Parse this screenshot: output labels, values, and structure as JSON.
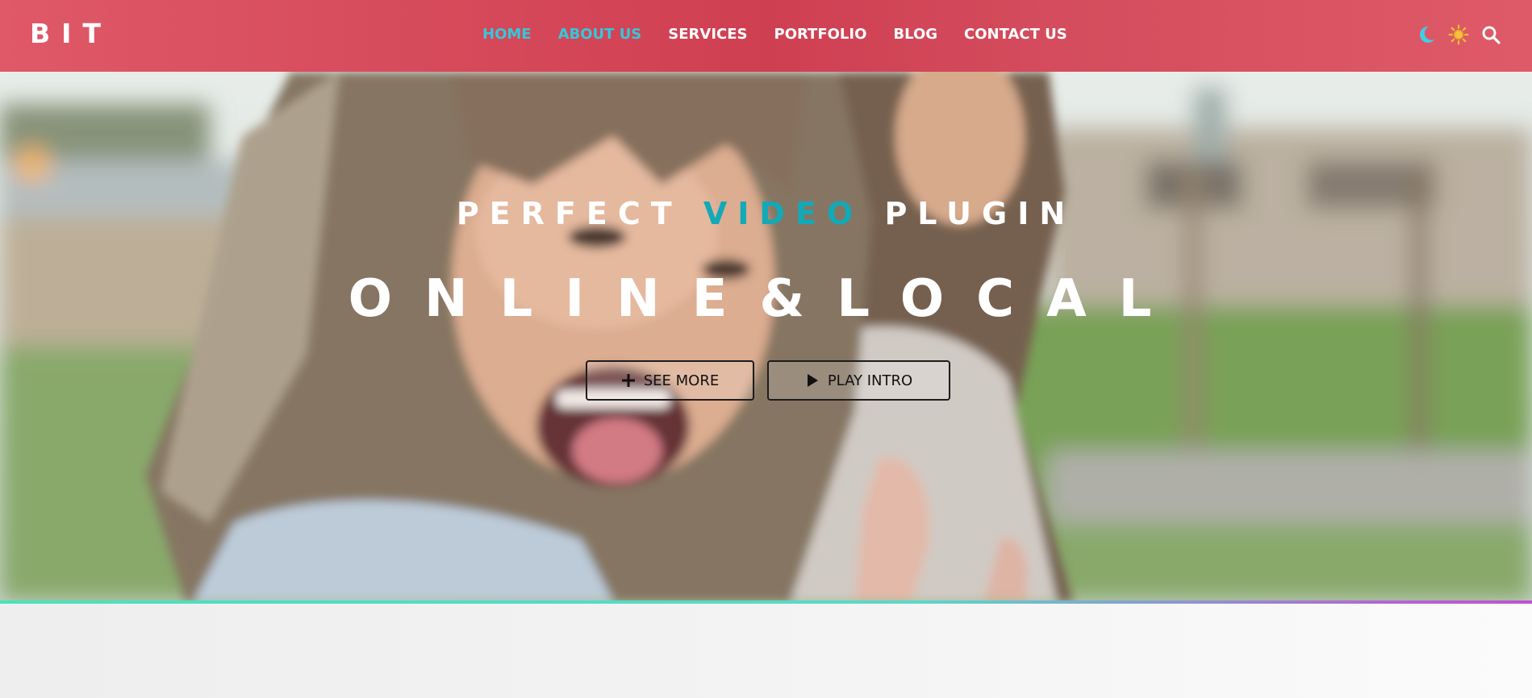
{
  "brand": {
    "logo_text": "BIT"
  },
  "nav": {
    "items": [
      {
        "label": "HOME",
        "active": true
      },
      {
        "label": "ABOUT US",
        "active": true
      },
      {
        "label": "SERVICES",
        "active": false
      },
      {
        "label": "PORTFOLIO",
        "active": false
      },
      {
        "label": "BLOG",
        "active": false
      },
      {
        "label": "CONTACT US",
        "active": false
      }
    ]
  },
  "header_icons": [
    "moon-icon",
    "sun-icon",
    "search-icon"
  ],
  "colors": {
    "header_bg": "#d44d5e",
    "nav_active": "#36c7d9",
    "subtitle_accent": "#13a9b8",
    "hero_divider_start": "#47e2bd",
    "hero_divider_end": "#c14fd5"
  },
  "hero": {
    "subtitle_prefix": "PERFECT",
    "subtitle_accent": "VIDEO",
    "subtitle_suffix": "PLUGIN",
    "title": "ONLINE&LOCAL",
    "buttons": {
      "see_more": {
        "label": "SEE MORE",
        "icon": "plus-icon"
      },
      "play_intro": {
        "label": "PLAY INTRO",
        "icon": "play-icon"
      }
    }
  }
}
